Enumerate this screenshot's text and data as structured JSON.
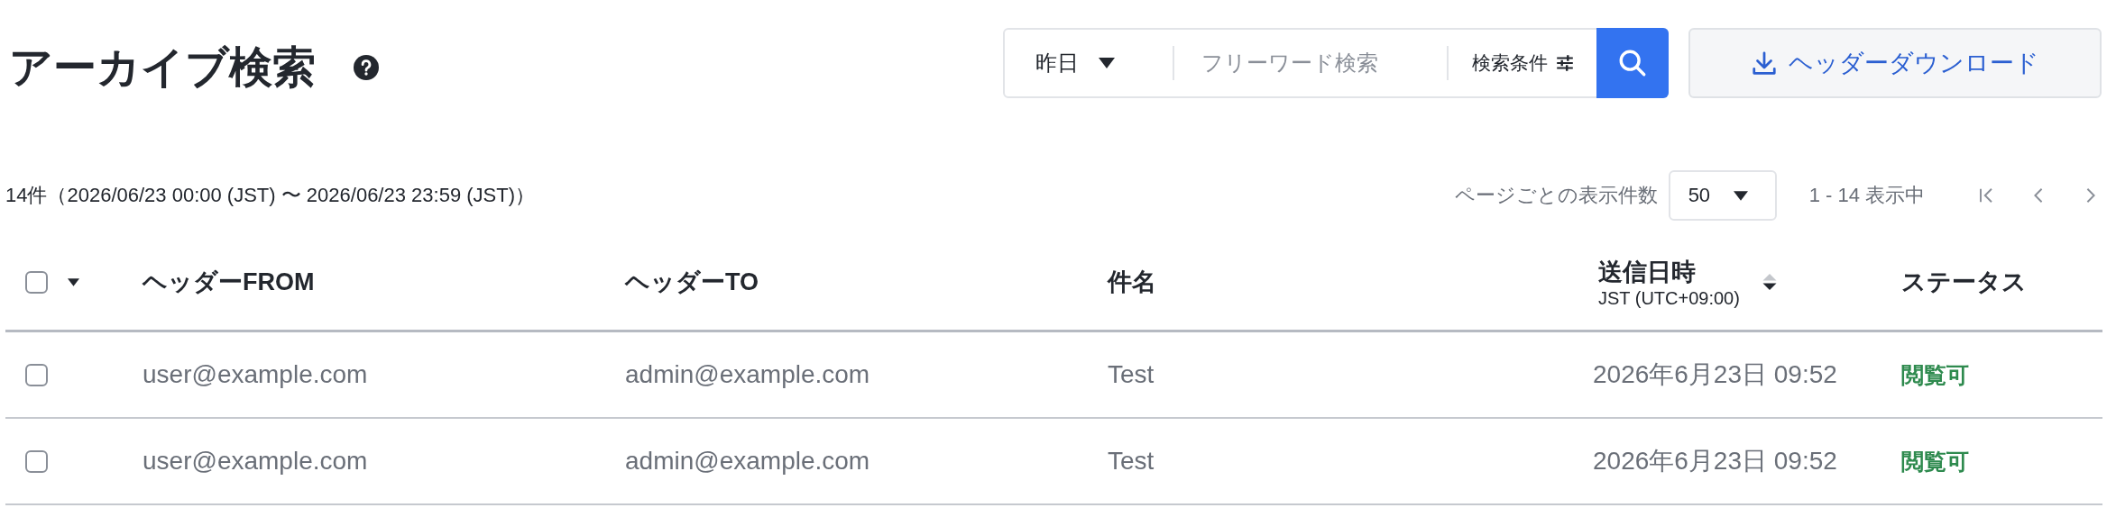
{
  "page_title": "アーカイブ検索",
  "search_bar": {
    "period": "昨日",
    "placeholder": "フリーワード検索",
    "conditions_label": "検索条件"
  },
  "download_button": "ヘッダーダウンロード",
  "summary": "14件（2026/06/23 00:00 (JST) 〜 2026/06/23 23:59 (JST)）",
  "pagination": {
    "per_page_label": "ページごとの表示件数",
    "per_page": "50",
    "range": "1 - 14 表示中"
  },
  "table": {
    "select_all_checked": false,
    "columns": [
      {
        "label": "ヘッダーFROM"
      },
      {
        "label": "ヘッダーTO"
      },
      {
        "label": "件名"
      },
      {
        "label": "送信日時",
        "sublabel": "JST (UTC+09:00)",
        "sortable": true
      },
      {
        "label": "ステータス"
      }
    ],
    "rows": [
      {
        "checked": false,
        "from": "user@example.com",
        "to": "admin@example.com",
        "subject": "Test",
        "sent": "2026年6月23日 09:52",
        "status": "閲覧可"
      },
      {
        "checked": false,
        "from": "user@example.com",
        "to": "admin@example.com",
        "subject": "Test",
        "sent": "2026年6月23日 09:52",
        "status": "閲覧可"
      }
    ]
  }
}
